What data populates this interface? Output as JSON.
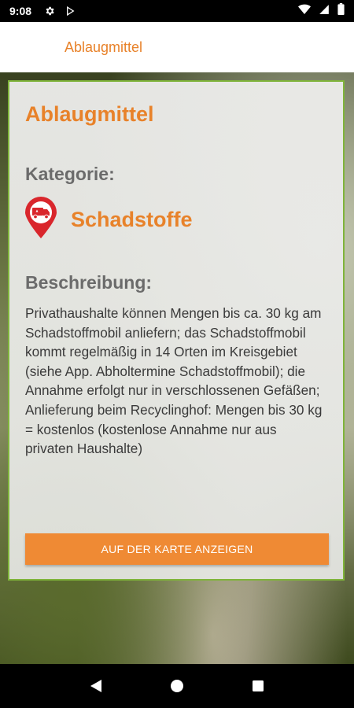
{
  "status_bar": {
    "time": "9:08",
    "icons": [
      "settings-icon",
      "play-store-icon",
      "wifi-icon",
      "signal-icon",
      "battery-icon"
    ]
  },
  "app_bar": {
    "title": "Ablaugmittel"
  },
  "card": {
    "title": "Ablaugmittel",
    "category_label": "Kategorie:",
    "category_name": "Schadstoffe",
    "category_icon": "hazmat-truck-pin-icon",
    "description_label": "Beschreibung:",
    "description": "Privathaushalte können Mengen bis ca. 30 kg am Schadstoffmobil anliefern; das Schadstoffmobil kommt regelmäßig in 14 Orten im Kreisgebiet (siehe App. Abholtermine Schadstoffmobil); die Annahme erfolgt nur in verschlossenen Gefäßen; Anlieferung beim Recyclinghof: Mengen bis 30 kg = kostenlos (kostenlose Annahme nur aus privaten Haushalte)",
    "map_button_label": "AUF DER KARTE ANZEIGEN"
  },
  "nav_bar": {
    "buttons": [
      "back-icon",
      "home-icon",
      "recents-icon"
    ]
  },
  "colors": {
    "accent": "#e8822a",
    "button": "#ef8a34",
    "card_border": "#7fb43a",
    "pin": "#d9262c"
  }
}
